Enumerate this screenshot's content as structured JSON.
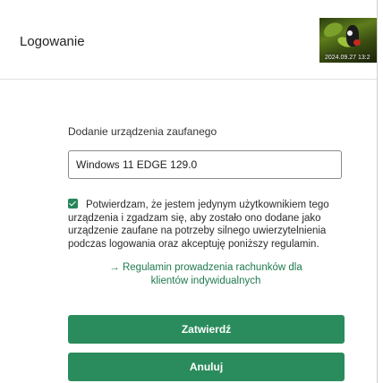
{
  "header": {
    "title": "Logowanie",
    "security_image": {
      "timestamp": "2024.09.27 13:2"
    }
  },
  "form": {
    "device_label": "Dodanie urządzenia zaufanego",
    "device_value": "Windows 11 EDGE 129.0",
    "consent_checked": true,
    "consent_text": "Potwierdzam, że jestem jedynym użytkownikiem tego urządzenia i zgadzam się, aby zostało ono dodane jako urządzenie zaufane na potrzeby silnego uwierzytelnienia podczas logowania oraz akceptuję poniższy regulamin.",
    "regulamin_arrow": "→",
    "regulamin_text": "Regulamin prowadzenia rachunków dla klientów indywidualnych"
  },
  "buttons": {
    "confirm_label": "Zatwierdź",
    "cancel_label": "Anuluj"
  },
  "colors": {
    "primary": "#2a8c5c",
    "link": "#1f7a4f"
  }
}
